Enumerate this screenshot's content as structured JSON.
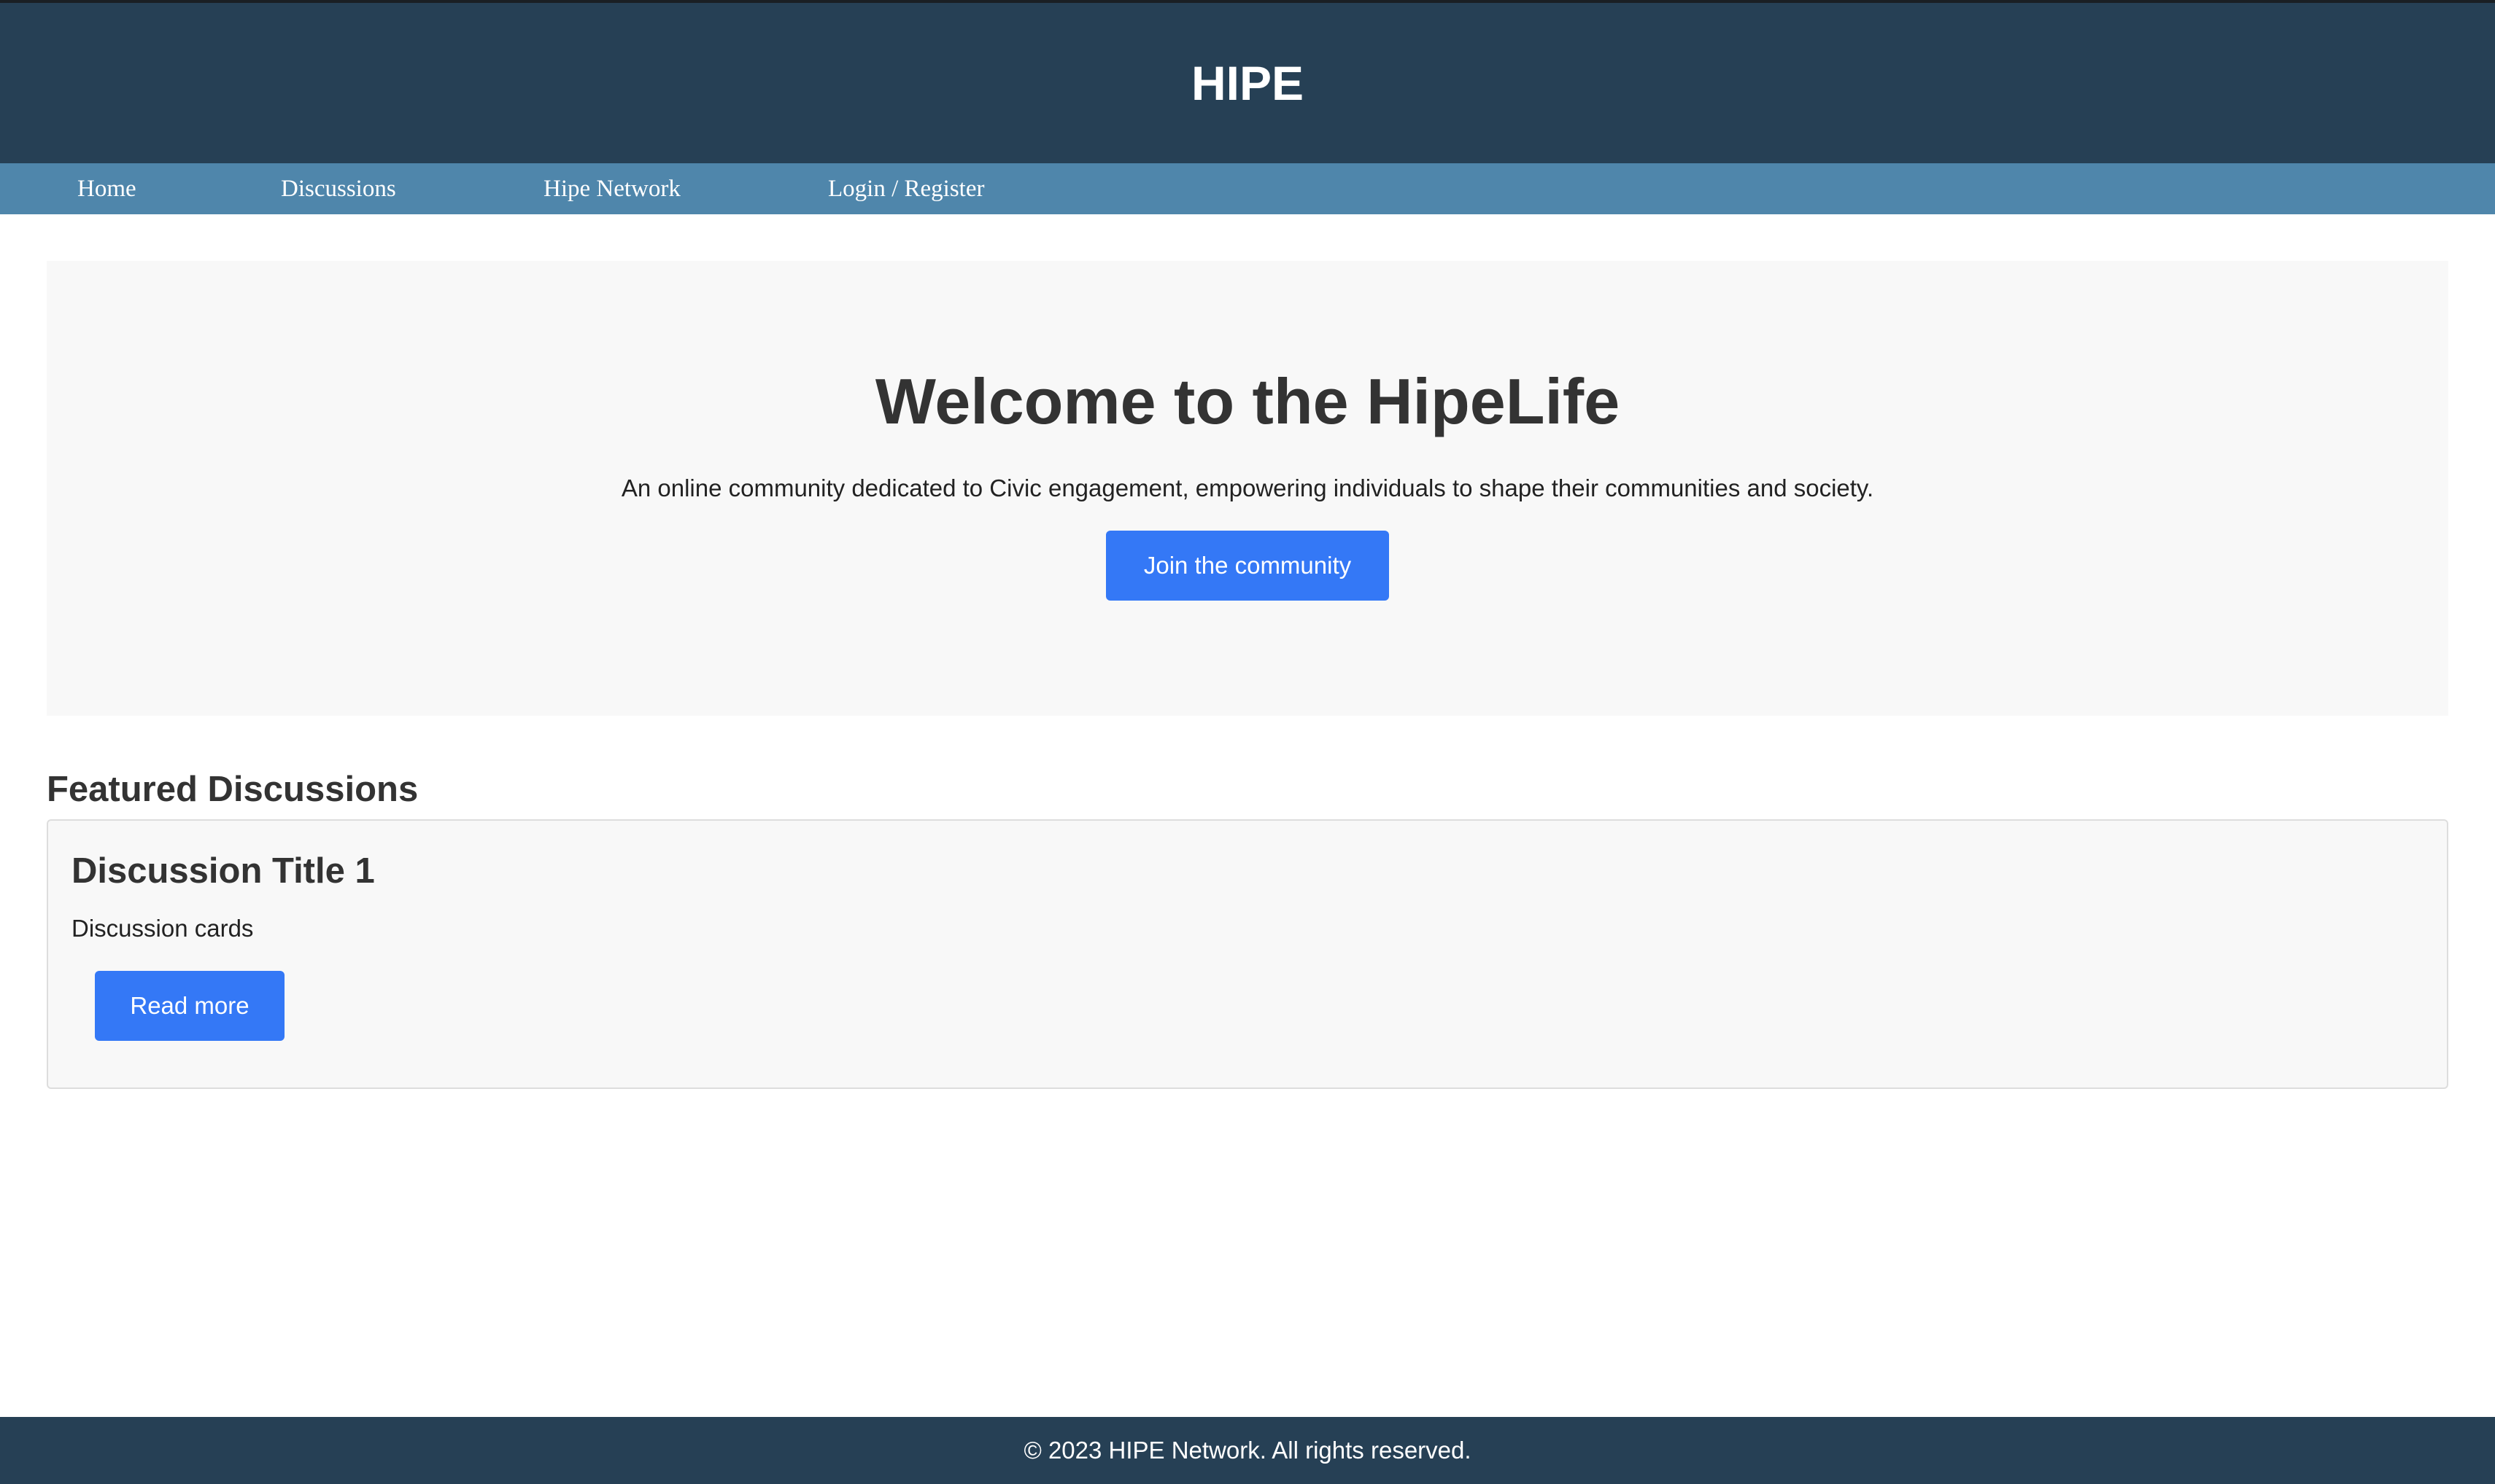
{
  "header": {
    "title": "HIPE"
  },
  "nav": {
    "items": [
      {
        "label": "Home"
      },
      {
        "label": "Discussions"
      },
      {
        "label": "Hipe Network"
      },
      {
        "label": "Login / Register"
      }
    ]
  },
  "hero": {
    "title": "Welcome to the HipeLife",
    "description": "An online community dedicated to Civic engagement, empowering individuals to shape their communities and society.",
    "button_label": "Join the community"
  },
  "featured": {
    "section_title": "Featured Discussions",
    "cards": [
      {
        "title": "Discussion Title 1",
        "description": "Discussion cards",
        "button_label": "Read more"
      }
    ]
  },
  "footer": {
    "text": "© 2023 HIPE Network. All rights reserved."
  },
  "colors": {
    "header_bg": "#264055",
    "nav_bg": "#4f86ab",
    "accent": "#3478f6",
    "panel_bg": "#f8f8f8"
  }
}
